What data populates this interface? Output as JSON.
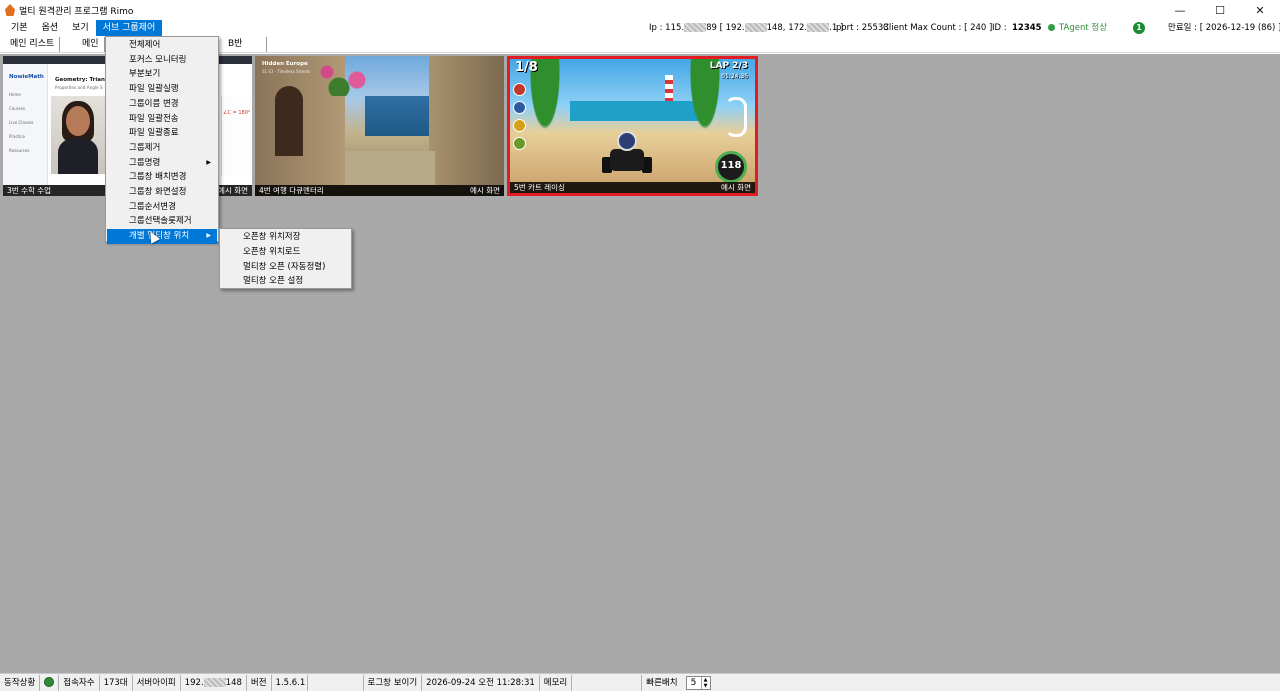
{
  "window": {
    "title": "멀티 원격관리 프로그램 Rimo",
    "minimize": "—",
    "maximize": "☐",
    "close": "✕"
  },
  "menubar": {
    "items": [
      "기본",
      "옵션",
      "보기",
      "서브 그룹제어"
    ]
  },
  "connection": {
    "ip_label": "Ip : 115.",
    "ip_suffix1": "89 [ 192.",
    "ip_suffix2": "148, 172.",
    "ip_suffix3": ".1 ]",
    "port_text": "port : 25533",
    "client_max_count": "Client Max Count : [ 240 ]",
    "id_label": "ID :",
    "id_value": "12345",
    "agent_status": "TAgent 정상",
    "badge_count": "1",
    "expiry": "만료일 : [ 2026-12-19 (86) ]"
  },
  "tabs": [
    "메인 리스트",
    "메인",
    "B반"
  ],
  "thumbnails": [
    {
      "label": "3번 수학 수업",
      "action": "예시 화면",
      "logo": "NowieMath",
      "headline": "Geometry: Triangle",
      "subline": "Properties and Angle S",
      "nav": [
        "Home",
        "Courses",
        "Live Classes",
        "Practice",
        "Resources"
      ],
      "equation": "∠C = 180°"
    },
    {
      "label": "4번 여행 다큐멘터리",
      "action": "예시 화면",
      "caption": "Hidden Europe",
      "caption_sub": "S1 E3 · Timeless Streets"
    },
    {
      "label": "5번 카트 레이싱",
      "action": "예시 화면",
      "position": "1/8",
      "lap": "LAP 2/3",
      "time": "01:24.36",
      "speed": "118"
    }
  ],
  "context_menu": {
    "items": [
      {
        "label": "전체제어",
        "submenu": false
      },
      {
        "label": "포커스 모니터링",
        "submenu": false
      },
      {
        "label": "부분보기",
        "submenu": false
      },
      {
        "label": "파일 일괄실행",
        "submenu": false
      },
      {
        "label": "그룹이름 변경",
        "submenu": false
      },
      {
        "label": "파일 일괄전송",
        "submenu": false
      },
      {
        "label": "파일 일괄종료",
        "submenu": false
      },
      {
        "label": "그룹제거",
        "submenu": false
      },
      {
        "label": "그룹명령",
        "submenu": true
      },
      {
        "label": "그룹창 배치변경",
        "submenu": false
      },
      {
        "label": "그룹창 화면설정",
        "submenu": false
      },
      {
        "label": "그룹순서변경",
        "submenu": false
      },
      {
        "label": "그룹선택솔롯제거",
        "submenu": false
      },
      {
        "label": "개별 멀티창 위치",
        "submenu": true
      }
    ],
    "highlighted_index": 13,
    "submenu_items": [
      "오픈창 위치저장",
      "오픈창 위치로드",
      "멀티창 오픈 (자동정렬)",
      "멀티창 오픈 설정"
    ]
  },
  "statusbar": {
    "status_label": "동작상황",
    "conn_label": "접속자수",
    "conn_count": "173대",
    "server_ip_label": "서버아이피",
    "server_ip_prefix": "192.",
    "server_ip_suffix": "148",
    "version_label": "버전",
    "version": "1.5.6.1",
    "log_button": "로그창 보이기",
    "datetime": "2026-09-24 오전 11:28:31",
    "memory_label": "메모리",
    "quick_layout_label": "빠른배치",
    "quick_layout_value": "5"
  },
  "colors": {
    "menu_highlight": "#0078d7",
    "workspace": "#a9a9a9",
    "selected_border": "#e31b23",
    "agent_ok": "#2e8b3a"
  }
}
